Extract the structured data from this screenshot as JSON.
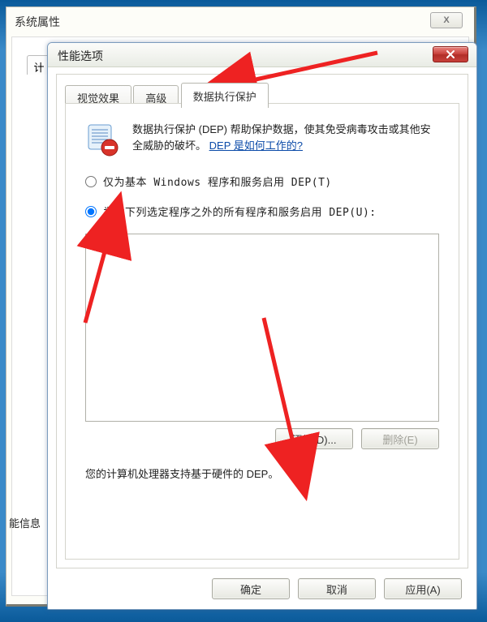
{
  "parent": {
    "title": "系统属性",
    "tab_stub": "计",
    "corner": "能信息"
  },
  "dialog": {
    "title": "性能选项",
    "tabs": {
      "visual": "视觉效果",
      "advanced": "高级",
      "dep": "数据执行保护"
    },
    "dep": {
      "desc1": "数据执行保护 (DEP) 帮助保护数据，使其免受病毒攻击或其他安全威胁的破坏。",
      "link": "DEP 是如何工作的?",
      "radio_basic": "仅为基本 Windows 程序和服务启用 DEP(T)",
      "radio_all": "为除下列选定程序之外的所有程序和服务启用 DEP(U):",
      "add": "添加(D)...",
      "remove": "删除(E)",
      "hw_support": "您的计算机处理器支持基于硬件的 DEP。"
    },
    "buttons": {
      "ok": "确定",
      "cancel": "取消",
      "apply": "应用(A)"
    }
  }
}
